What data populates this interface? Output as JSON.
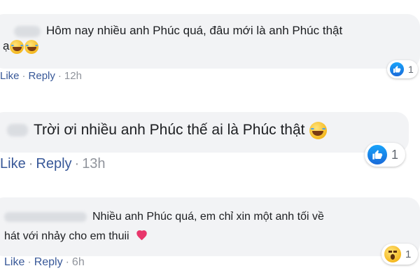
{
  "comments": [
    {
      "text_line1": "Hôm nay nhiều anh Phúc quá, đâu mới là anh Phúc thật",
      "text_line2": "ạ",
      "like_label": "Like",
      "reply_label": "Reply",
      "separator": "·",
      "time": "12h",
      "reaction_count": "1",
      "reaction_icon": "like-icon",
      "emojis": [
        "laughing-tears-emoji",
        "laughing-tears-emoji"
      ]
    },
    {
      "text_line1": "Trời ơi nhiều anh Phúc thế ai là Phúc thật",
      "like_label": "Like",
      "reply_label": "Reply",
      "separator": "·",
      "time": "13h",
      "reaction_count": "1",
      "reaction_icon": "like-icon",
      "emojis": [
        "laughing-tears-emoji"
      ]
    },
    {
      "text_line1": "Nhiều anh Phúc quá, em chỉ xin một anh tối về",
      "text_line2": "hát với nhảy cho em thuii",
      "like_label": "Like",
      "reply_label": "Reply",
      "separator": "·",
      "time": "6h",
      "reaction_count": "1",
      "reaction_icon": "wow-icon",
      "emojis": [
        "sparkling-heart-emoji"
      ]
    }
  ],
  "colors": {
    "bubble": "#f2f3f5",
    "link": "#385898",
    "meta_gray": "#90949c",
    "like_blue": "#1877f2"
  }
}
